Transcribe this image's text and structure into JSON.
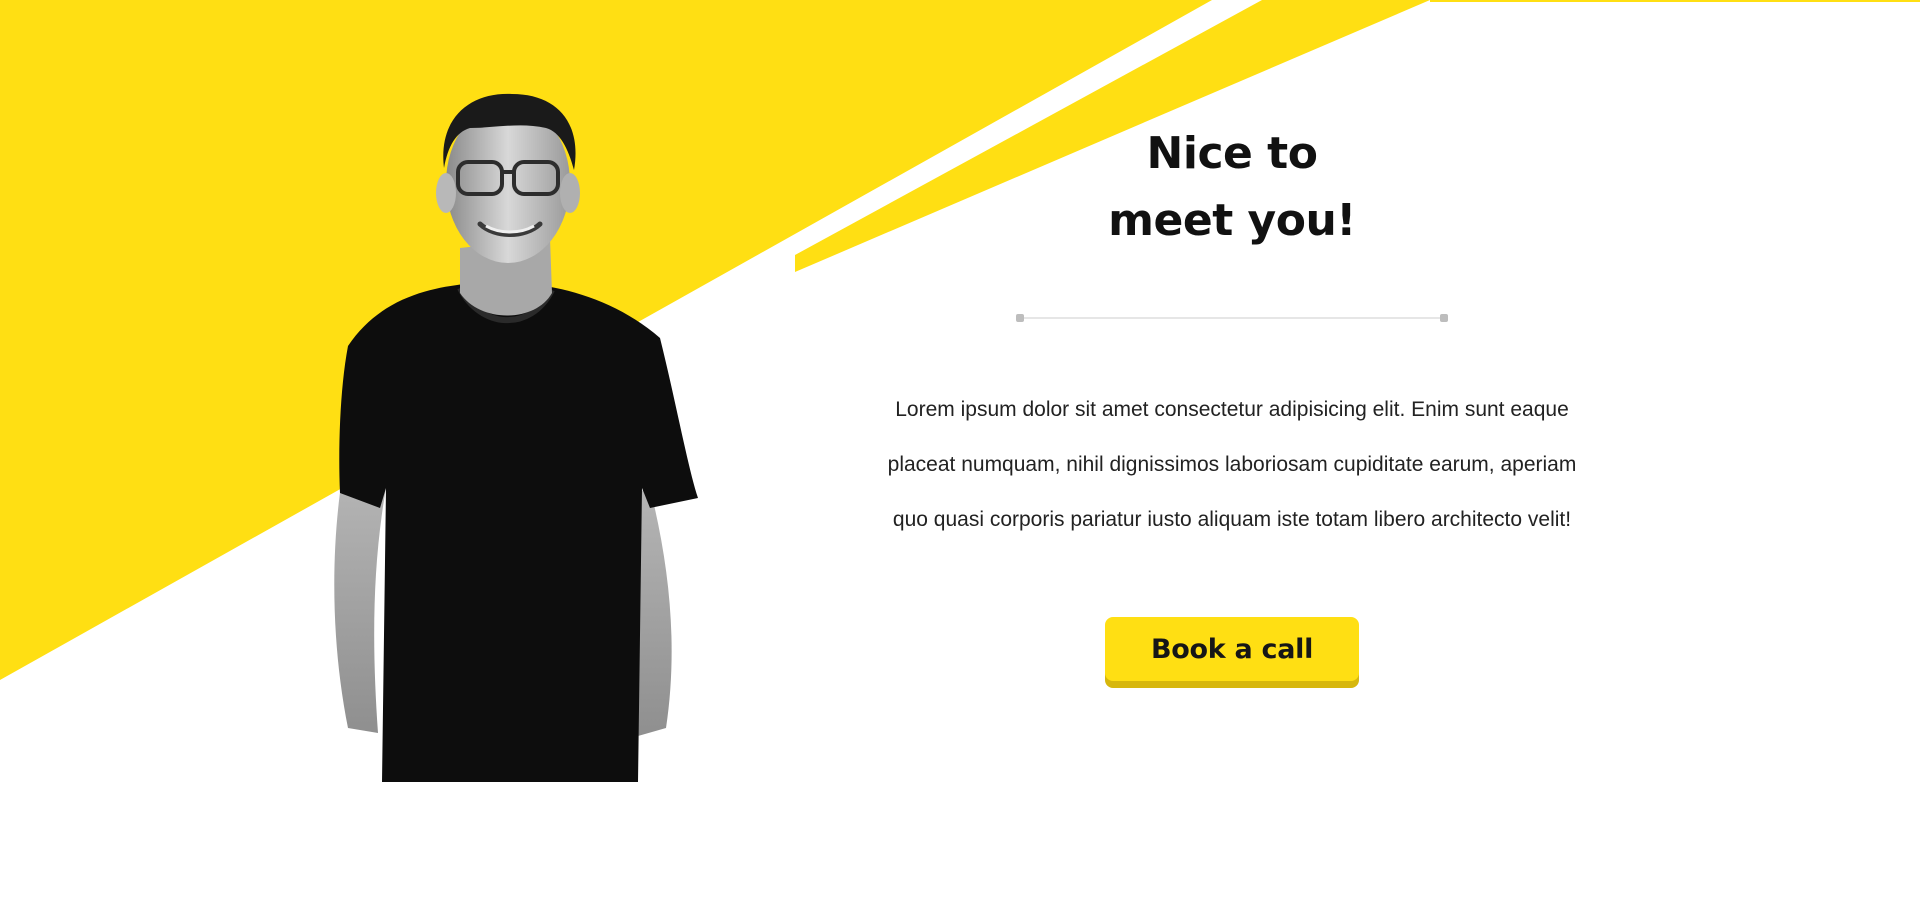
{
  "colors": {
    "accent_yellow": "#ffdf13",
    "button_shadow": "#d7b70d",
    "text_dark": "#111111"
  },
  "hero": {
    "heading_line1": "Nice to",
    "heading_line2": "meet you!",
    "body": "Lorem ipsum dolor sit amet consectetur adipisicing elit. Enim sunt eaque placeat numquam, nihil dignissimos laboriosam cupiditate earum, aperiam quo quasi corporis pariatur iusto aliquam iste totam libero architecto velit!",
    "cta_label": "Book a call"
  },
  "images": {
    "portrait": "portrait-photo"
  }
}
